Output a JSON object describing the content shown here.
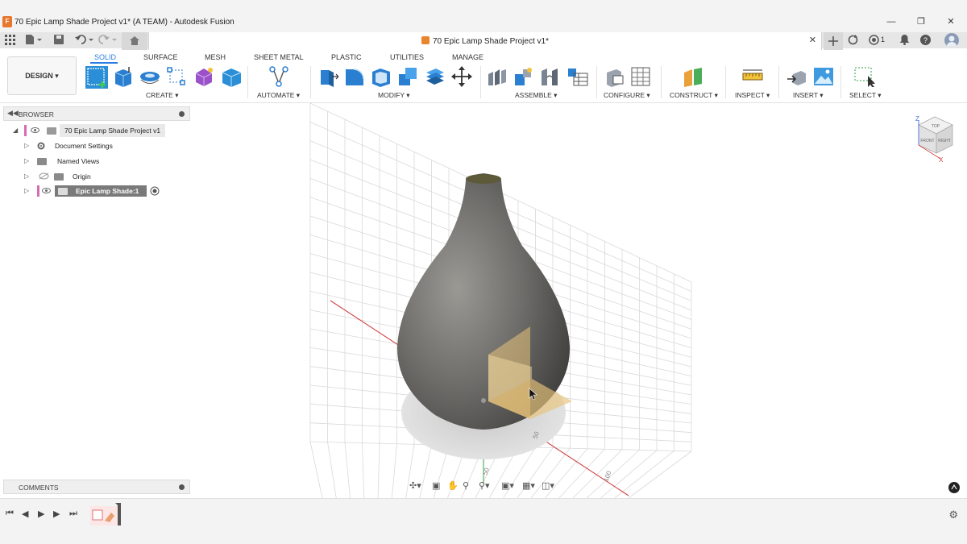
{
  "window": {
    "title": "70 Epic Lamp Shade Project v1* (A TEAM) - Autodesk Fusion",
    "minimize": "—",
    "restore": "❐",
    "close": "✕"
  },
  "document_tab": {
    "title": "70 Epic Lamp Shade Project v1*",
    "close": "✕"
  },
  "quick_access": {
    "job_count": "1"
  },
  "workspace": {
    "label": "DESIGN ▾"
  },
  "tabs": [
    "SOLID",
    "SURFACE",
    "MESH",
    "SHEET METAL",
    "PLASTIC",
    "UTILITIES",
    "MANAGE"
  ],
  "active_tab": "SOLID",
  "groups": {
    "create": "CREATE ▾",
    "automate": "AUTOMATE ▾",
    "modify": "MODIFY ▾",
    "assemble": "ASSEMBLE ▾",
    "configure": "CONFIGURE ▾",
    "construct": "CONSTRUCT ▾",
    "inspect": "INSPECT ▾",
    "insert": "INSERT ▾",
    "select": "SELECT ▾"
  },
  "browser": {
    "title": "BROWSER",
    "root": "70 Epic Lamp Shade Project v1",
    "items": [
      "Document Settings",
      "Named Views",
      "Origin",
      "Epic Lamp Shade:1"
    ]
  },
  "comments": {
    "title": "COMMENTS"
  },
  "viewcube": {
    "top": "TOP",
    "front": "FRONT",
    "right": "RIGHT",
    "axis_z": "Z",
    "axis_x": "X"
  },
  "axis_ticks": [
    "50",
    "50",
    "100"
  ],
  "colors": {
    "accent": "#2a7de1",
    "body": "#6e6d6a",
    "sketch_plane": "#e8c37a",
    "x_axis": "#d04040",
    "y_axis": "#3fae4a",
    "component_marker": "#d96bb3"
  }
}
